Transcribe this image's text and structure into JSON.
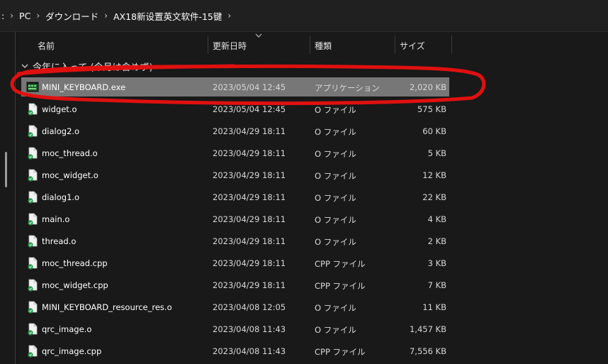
{
  "breadcrumb": {
    "items": [
      ":",
      "PC",
      "ダウンロード",
      "AX18新设置英文软件-15键"
    ]
  },
  "columns": {
    "name": "名前",
    "date": "更新日時",
    "type": "種類",
    "size": "サイズ"
  },
  "group": {
    "label": "今年に入って (今月は含めず)"
  },
  "files": [
    {
      "name": "MINI_KEYBOARD.exe",
      "date": "2023/05/04 12:45",
      "type": "アプリケーション",
      "size": "2,020 KB",
      "icon": "exe-icon",
      "selected": true
    },
    {
      "name": "widget.o",
      "date": "2023/05/04 12:45",
      "type": "O ファイル",
      "size": "575 KB",
      "icon": "file-icon"
    },
    {
      "name": "dialog2.o",
      "date": "2023/04/29 18:11",
      "type": "O ファイル",
      "size": "60 KB",
      "icon": "file-icon"
    },
    {
      "name": "moc_thread.o",
      "date": "2023/04/29 18:11",
      "type": "O ファイル",
      "size": "5 KB",
      "icon": "file-icon"
    },
    {
      "name": "moc_widget.o",
      "date": "2023/04/29 18:11",
      "type": "O ファイル",
      "size": "12 KB",
      "icon": "file-icon"
    },
    {
      "name": "dialog1.o",
      "date": "2023/04/29 18:11",
      "type": "O ファイル",
      "size": "22 KB",
      "icon": "file-icon"
    },
    {
      "name": "main.o",
      "date": "2023/04/29 18:11",
      "type": "O ファイル",
      "size": "4 KB",
      "icon": "file-icon"
    },
    {
      "name": "thread.o",
      "date": "2023/04/29 18:11",
      "type": "O ファイル",
      "size": "2 KB",
      "icon": "file-icon"
    },
    {
      "name": "moc_thread.cpp",
      "date": "2023/04/29 18:11",
      "type": "CPP ファイル",
      "size": "3 KB",
      "icon": "file-icon"
    },
    {
      "name": "moc_widget.cpp",
      "date": "2023/04/29 18:11",
      "type": "CPP ファイル",
      "size": "7 KB",
      "icon": "file-icon"
    },
    {
      "name": "MINI_KEYBOARD_resource_res.o",
      "date": "2023/04/08 12:05",
      "type": "O ファイル",
      "size": "11 KB",
      "icon": "file-icon"
    },
    {
      "name": "qrc_image.o",
      "date": "2023/04/08 11:43",
      "type": "O ファイル",
      "size": "1,457 KB",
      "icon": "file-icon"
    },
    {
      "name": "qrc_image.cpp",
      "date": "2023/04/08 11:43",
      "type": "CPP ファイル",
      "size": "7,556 KB",
      "icon": "file-icon"
    }
  ],
  "colors": {
    "background": "#191919",
    "selected_row": "#777777",
    "annotation": "#e01010",
    "file_badge": "#1f9d48"
  }
}
